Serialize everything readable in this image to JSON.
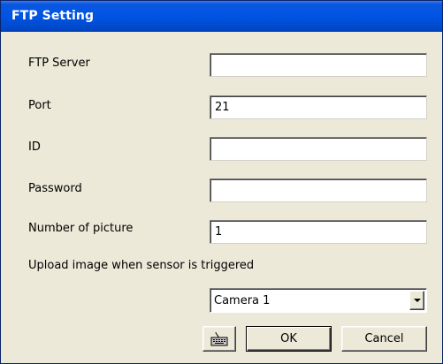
{
  "window": {
    "title": "FTP Setting"
  },
  "form": {
    "ftp_server": {
      "label": "FTP Server",
      "value": ""
    },
    "port": {
      "label": "Port",
      "value": "21"
    },
    "id": {
      "label": "ID",
      "value": ""
    },
    "password": {
      "label": "Password",
      "value": ""
    },
    "number_of_picture": {
      "label": "Number of picture",
      "value": "1"
    },
    "upload_label": "Upload image when sensor is triggered",
    "camera_select": {
      "selected": "Camera 1"
    }
  },
  "buttons": {
    "keyboard_icon": "keyboard-icon",
    "ok": "OK",
    "cancel": "Cancel"
  },
  "colors": {
    "titlebar": "#0054e3",
    "window_bg": "#ece9d8",
    "title_text": "#ffffff"
  }
}
